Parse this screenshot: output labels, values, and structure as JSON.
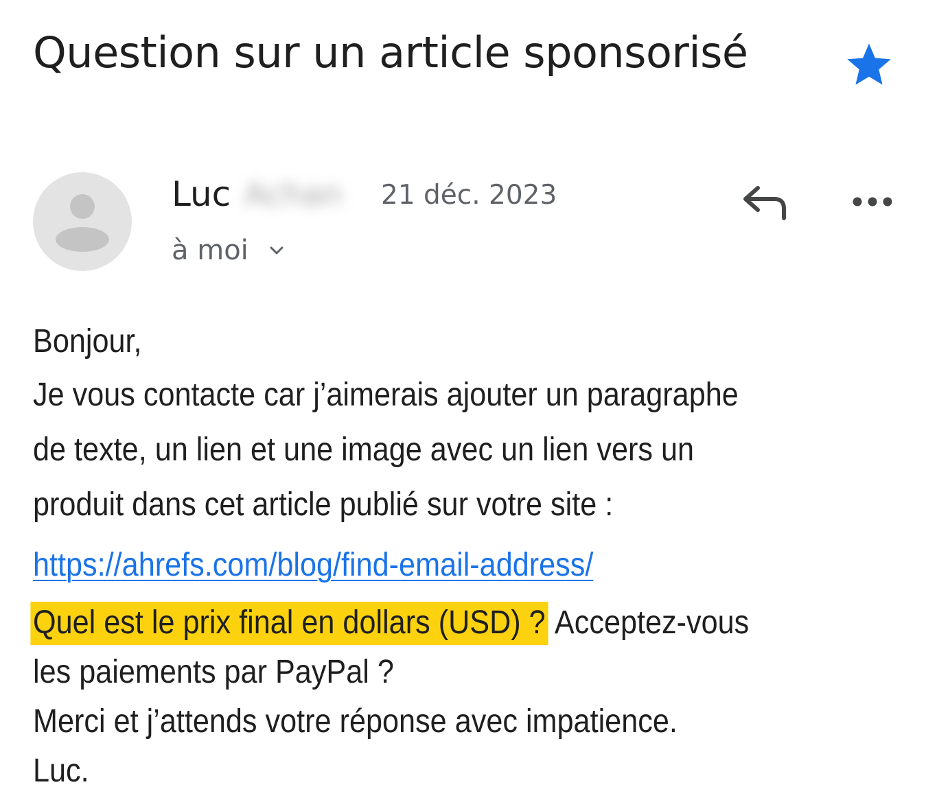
{
  "email": {
    "subject": "Question sur un article sponsorisé",
    "starred": true,
    "star_color": "#1a73e8",
    "sender": {
      "first_name": "Luc",
      "surname_blurred": "Achan"
    },
    "date": "21 déc. 2023",
    "recipient_label": "à moi",
    "icons": {
      "star": "star-filled-icon",
      "avatar": "person-avatar-icon",
      "reply": "reply-arrow-icon",
      "more": "more-dots-icon",
      "expand": "chevron-down-icon"
    },
    "body": {
      "greeting": "Bonjour,",
      "para_line1": "Je vous contacte car j’aimerais ajouter un paragraphe",
      "para_line2": "de texte, un lien et une image avec un lien vers un",
      "para_line3": "produit dans cet article publié sur votre site :",
      "link": "https://ahrefs.com/blog/find-email-address/",
      "highlighted_question": "Quel est le prix final en dollars (USD) ?",
      "question_rest": " Acceptez-vous",
      "question_line2": "les paiements par PayPal ?",
      "thanks": "Merci et j’attends votre réponse avec impatience.",
      "signature": "Luc.",
      "highlight_color": "#fcd20f",
      "link_color": "#1a73e8"
    }
  }
}
